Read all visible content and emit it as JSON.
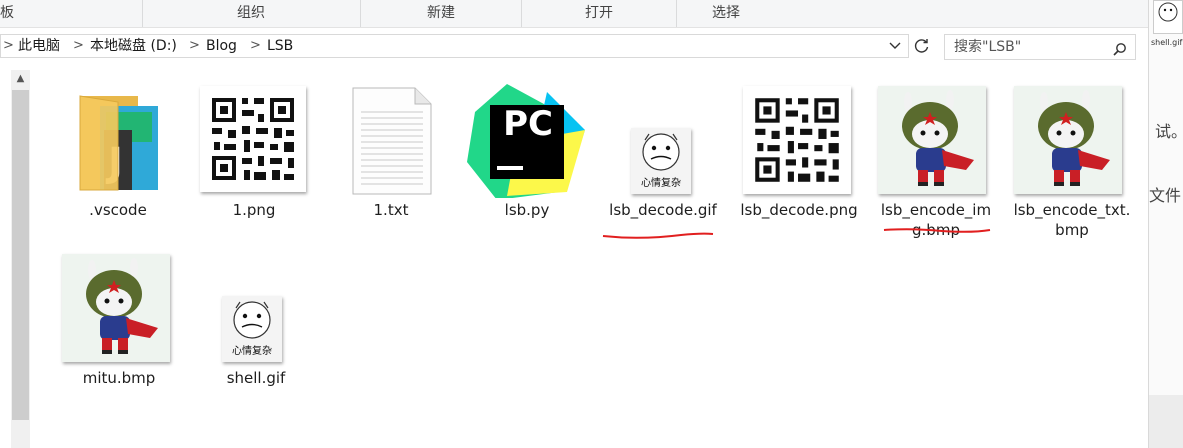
{
  "ribbon": {
    "groups": [
      "板",
      "组织",
      "新建",
      "打开",
      "选择"
    ]
  },
  "address_bar": {
    "crumbs": [
      "此电脑",
      "本地磁盘 (D:)",
      "Blog",
      "LSB"
    ],
    "separator": ">"
  },
  "search": {
    "placeholder": "搜索\"LSB\""
  },
  "files": [
    {
      "name": ".vscode",
      "kind": "folder"
    },
    {
      "name": "1.png",
      "kind": "qr-image"
    },
    {
      "name": "1.txt",
      "kind": "text-file"
    },
    {
      "name": "lsb.py",
      "kind": "pycharm-file"
    },
    {
      "name": "lsb_decode.gif",
      "kind": "meme-gif",
      "annotated": true
    },
    {
      "name": "lsb_decode.png",
      "kind": "qr-image"
    },
    {
      "name": "lsb_encode_img.bmp",
      "kind": "mitu-bmp",
      "annotated": true
    },
    {
      "name": "lsb_encode_txt.bmp",
      "kind": "mitu-bmp"
    },
    {
      "name": "mitu.bmp",
      "kind": "mitu-bmp"
    },
    {
      "name": "shell.gif",
      "kind": "meme-gif"
    }
  ],
  "meme_caption": "心情复杂",
  "pycharm_logo_text": "PC",
  "right_panel": {
    "thumb_label": "shell.gif",
    "text_fragment_1": "试。",
    "text_fragment_2": "文件"
  },
  "colors": {
    "annotation_red": "#e11f1f",
    "folder_yellow": "#f4c95d",
    "pycharm_green": "#21d789",
    "pycharm_yellow": "#fcf84a",
    "pycharm_blue": "#07c3f2"
  }
}
